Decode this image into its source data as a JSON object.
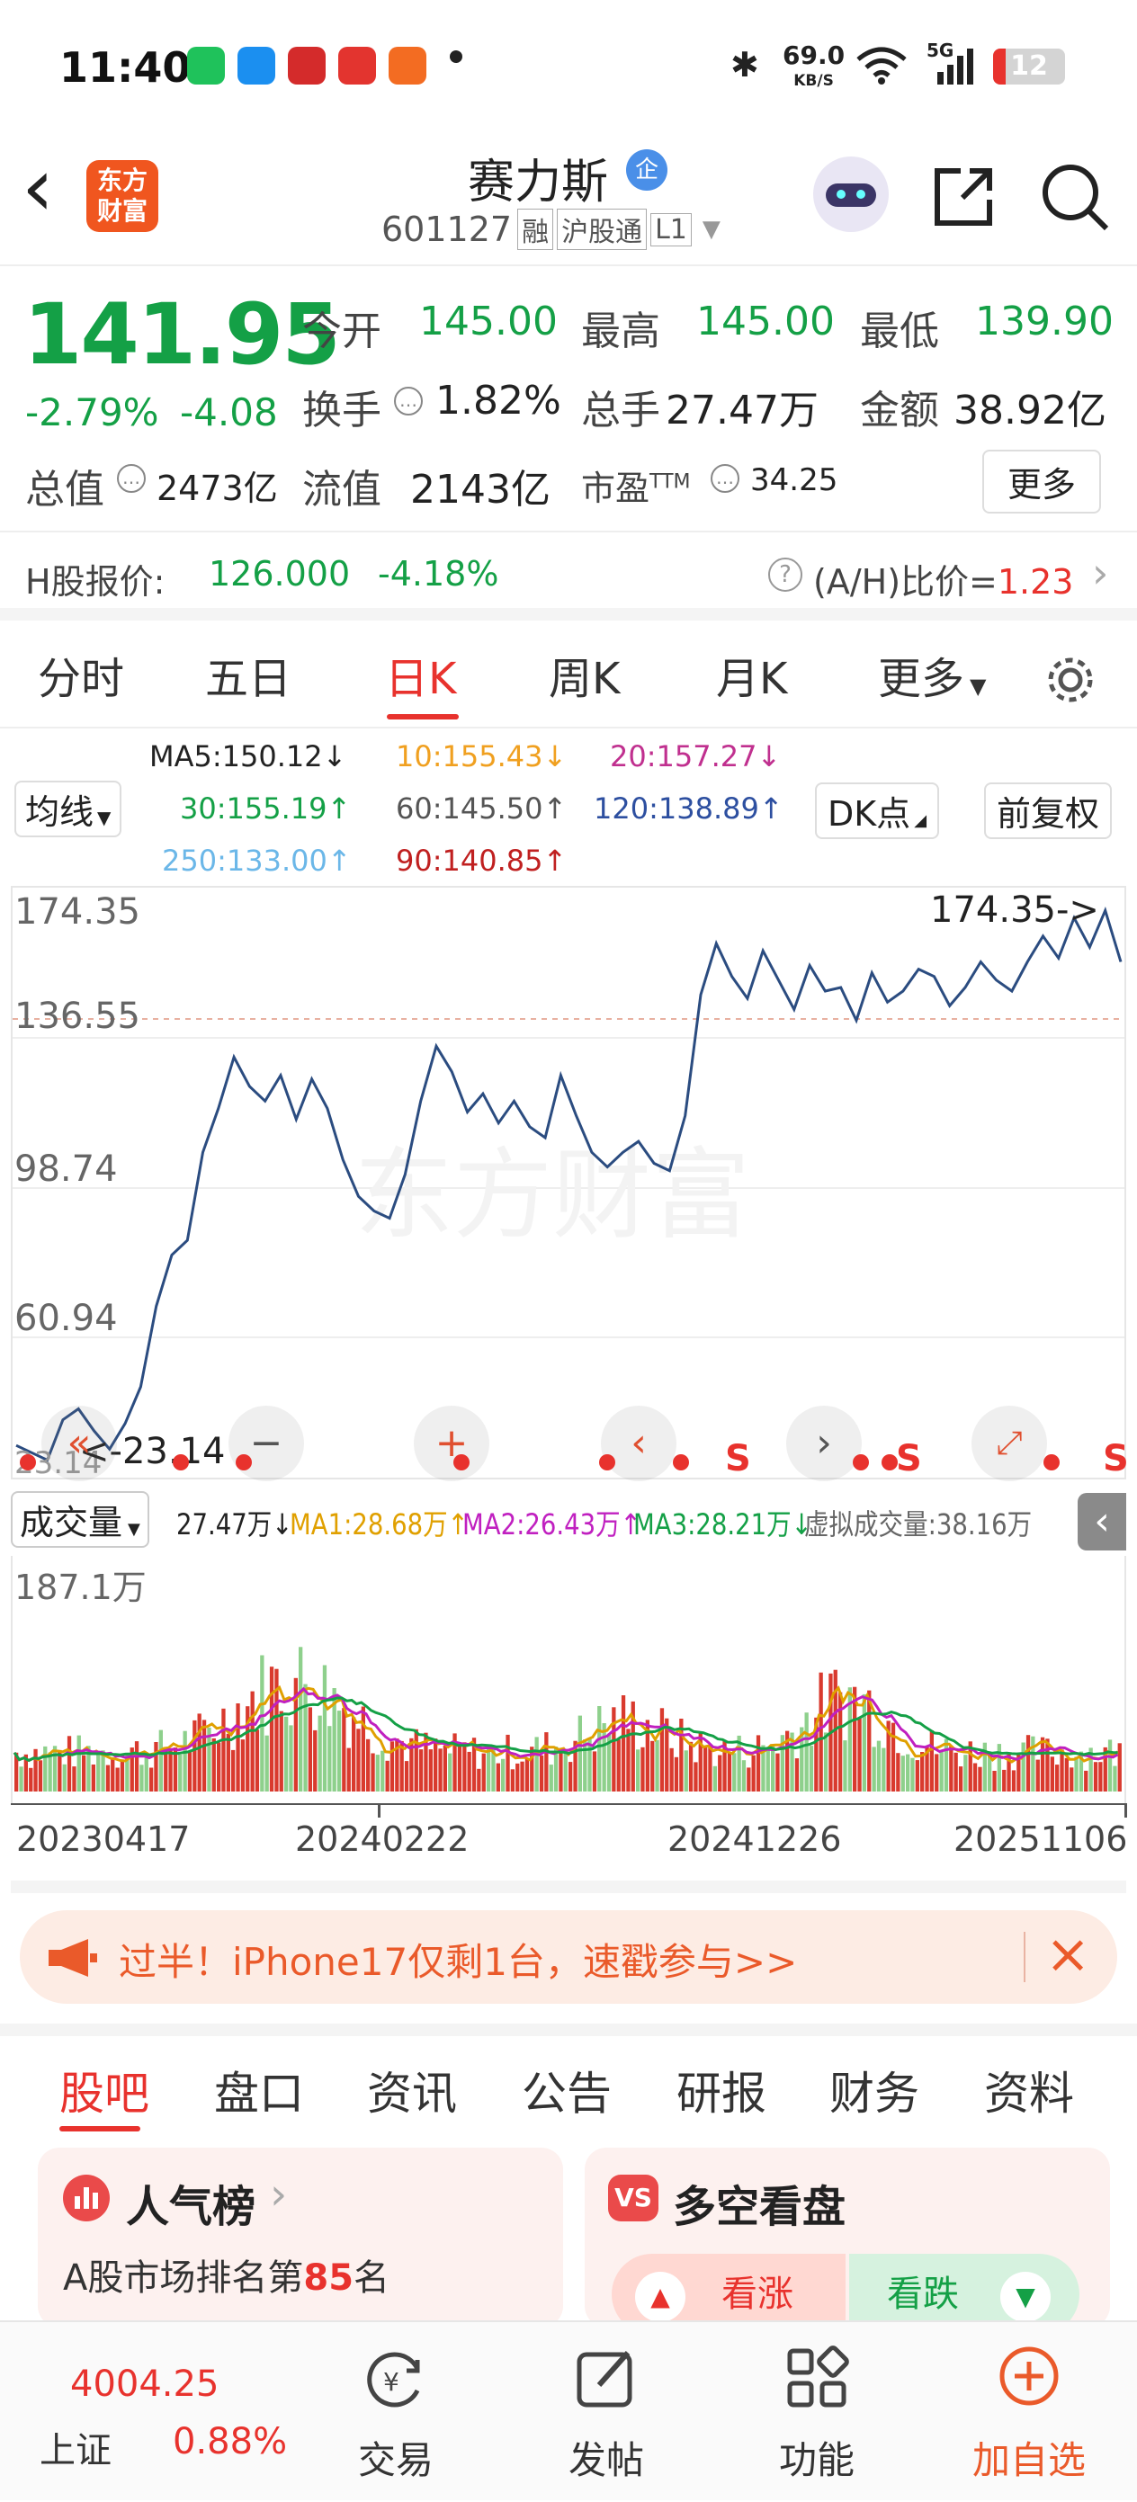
{
  "status": {
    "time": "11:40",
    "net_speed": "69.0",
    "net_unit": "KB/S",
    "network": "5G",
    "battery": "12"
  },
  "header": {
    "back": "‹",
    "logo_line1": "东方",
    "logo_line2": "财富",
    "name": "赛力斯",
    "enterprise_badge": "企",
    "code": "601127",
    "tag1": "融",
    "tag2": "沪股通",
    "tag3": "L1"
  },
  "quote": {
    "price": "141.95",
    "change_pct": "-2.79%",
    "change": "-4.08",
    "open_label": "今开",
    "open": "145.00",
    "high_label": "最高",
    "high": "145.00",
    "low_label": "最低",
    "low": "139.90",
    "turnover_label": "换手",
    "turnover": "1.82%",
    "volume_label": "总手",
    "volume": "27.47万",
    "amount_label": "金额",
    "amount": "38.92亿",
    "mktcap_label": "总值",
    "mktcap": "2473亿",
    "float_label": "流值",
    "float": "2143亿",
    "pe_label": "市盈",
    "pe_sup": "TTM",
    "pe": "34.25",
    "more": "更多"
  },
  "hshare": {
    "label": "H股报价:",
    "price": "126.000",
    "pct": "-4.18%",
    "ratio_label": "(A/H)比价=",
    "ratio": "1.23"
  },
  "tabs": [
    "分时",
    "五日",
    "日K",
    "周K",
    "月K",
    "更多"
  ],
  "active_tab": "日K",
  "ma": {
    "ma5": "MA5:150.12↓",
    "ma10": "10:155.43↓",
    "ma20": "20:157.27↓",
    "ma30": "30:155.19↑",
    "ma60": "60:145.50↑",
    "ma120": "120:138.89↑",
    "ma250": "250:133.00↑",
    "ma90": "90:140.85↑",
    "selector": "均线",
    "dk": "DK点",
    "adjust": "前复权"
  },
  "chart_data": {
    "type": "line",
    "y_ticks": [
      "174.35",
      "136.55",
      "98.74",
      "60.94",
      "23.14"
    ],
    "ylim": [
      23.14,
      174.35
    ],
    "max_label": "174.35->",
    "min_label": "<-23.14",
    "x_ticks": [
      "20230417",
      "20240222",
      "20241226",
      "20251106"
    ],
    "series": [
      {
        "values": [
          28,
          26,
          24,
          35,
          38,
          32,
          27,
          34,
          44,
          66,
          80,
          84,
          108,
          120,
          134,
          126,
          122,
          129,
          117,
          128,
          120,
          106,
          96,
          92,
          90,
          102,
          122,
          137,
          130,
          119,
          124,
          116,
          122,
          115,
          112,
          129,
          118,
          108,
          104,
          108,
          111,
          105,
          103,
          118,
          151,
          165,
          156,
          150,
          163,
          155,
          147,
          159,
          152,
          153,
          144,
          157,
          149,
          152,
          158,
          156,
          148,
          153,
          160,
          155,
          152,
          160,
          167,
          161,
          172,
          164,
          174,
          160
        ]
      }
    ],
    "color": "#2b4c80"
  },
  "volume": {
    "selector": "成交量",
    "vol": "27.47万↓",
    "ma1": "MA1:28.68万↑",
    "ma2": "MA2:26.43万↑",
    "ma3": "MA3:28.21万↓",
    "virtual": "虚拟成交量:38.16万",
    "max": "187.1万"
  },
  "banner": {
    "text": "过半！iPhone17仅剩1台，速戳参与>>"
  },
  "subtabs": [
    "股吧",
    "盘口",
    "资讯",
    "公告",
    "研报",
    "财务",
    "资料"
  ],
  "cards": {
    "pop_title": "人气榜",
    "pop_rank_pre": "A股市场排名第",
    "pop_rank": "85",
    "pop_rank_post": "名",
    "bull_title": "多空看盘",
    "bull_up": "看涨",
    "bull_down": "看跌"
  },
  "bottom": {
    "index": "4004.25",
    "index_name": "上证",
    "index_pct": "0.88%",
    "trade": "交易",
    "post": "发帖",
    "func": "功能",
    "fav": "加自选"
  }
}
